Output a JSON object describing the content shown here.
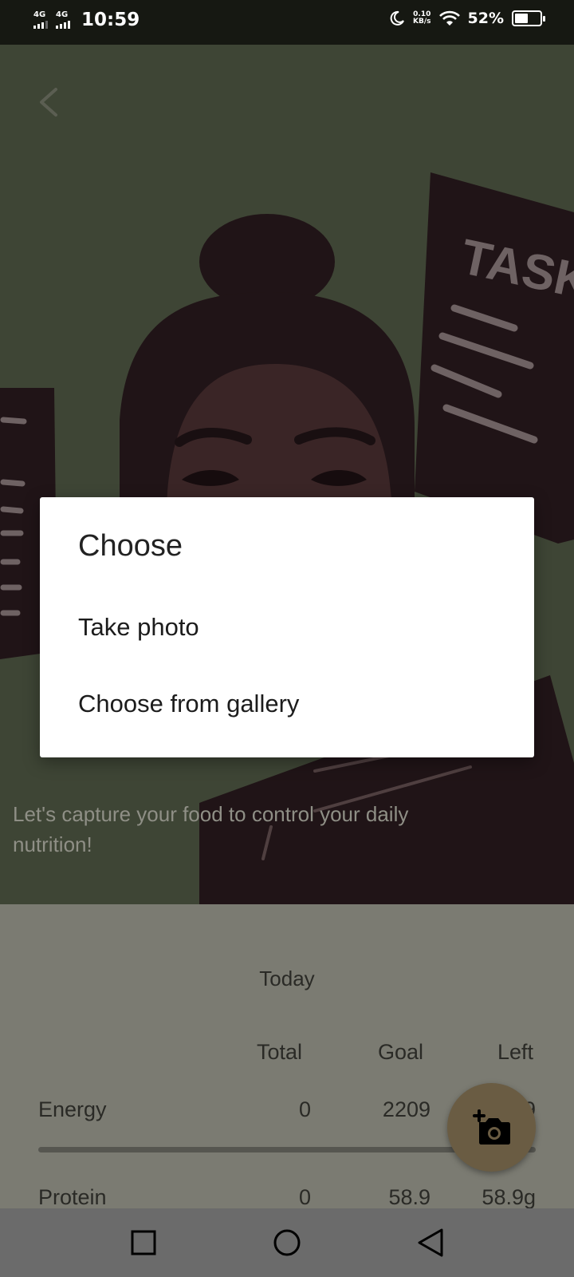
{
  "status_bar": {
    "net1": "4G",
    "net2": "4G",
    "time": "10:59",
    "speed_value": "0.10",
    "speed_unit": "KB/s",
    "battery_percent": "52%",
    "battery_level": 0.52,
    "icons": [
      "signal-icon",
      "moon-icon",
      "wifi-icon",
      "battery-icon"
    ]
  },
  "hero": {
    "back_icon": "chevron-left-icon",
    "illustration_text": "TASK",
    "caption": "Let's capture your food to control your daily nutrition!"
  },
  "nutrition": {
    "title": "Today",
    "columns": [
      "Total",
      "Goal",
      "Left"
    ],
    "rows": [
      {
        "label": "Energy",
        "total": "0",
        "goal": "2209",
        "left": "2209"
      },
      {
        "label": "Protein",
        "total": "0",
        "goal": "58.9",
        "left": "58.9g"
      }
    ]
  },
  "fab": {
    "icon": "add-photo-icon"
  },
  "dialog": {
    "title": "Choose",
    "options": [
      "Take photo",
      "Choose from gallery"
    ]
  },
  "nav_bar": {
    "icons": [
      "recents-square-icon",
      "home-circle-icon",
      "back-triangle-icon"
    ]
  },
  "colors": {
    "status_bar": "#161812",
    "hero_bg": "#3e4535",
    "overlay_surface": "#7b7b72",
    "fab": "#6a5c43",
    "dialog_bg": "#ffffff"
  }
}
